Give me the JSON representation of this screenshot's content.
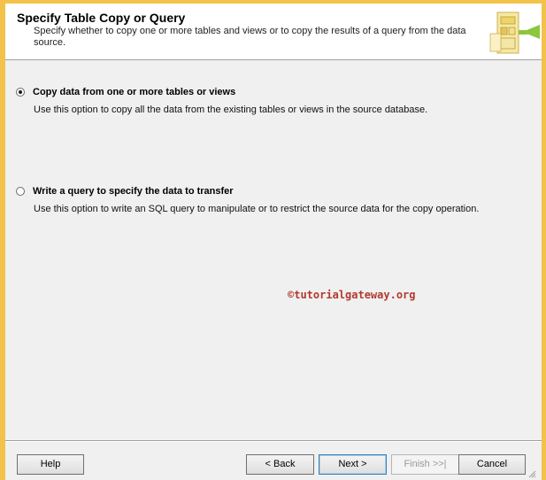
{
  "header": {
    "title": "Specify Table Copy or Query",
    "description": "Specify whether to copy one or more tables and views or to copy the results of a query from the data source.",
    "icon": "wizard-table-icon"
  },
  "options": [
    {
      "label": "Copy data from one or more tables or views",
      "description": "Use this option to copy all the data from the existing tables or views in the source database.",
      "selected": true
    },
    {
      "label": "Write a query to specify the data to transfer",
      "description": "Use this option to write an SQL query to manipulate or to restrict the source data for the copy operation.",
      "selected": false
    }
  ],
  "watermark": "©tutorialgateway.org",
  "buttons": {
    "help": "Help",
    "back": "< Back",
    "next": "Next >",
    "finish": "Finish >>|",
    "cancel": "Cancel"
  },
  "colors": {
    "window_border": "#f3c24b",
    "watermark": "#b03a2e",
    "default_button_border": "#3c7fb1"
  }
}
